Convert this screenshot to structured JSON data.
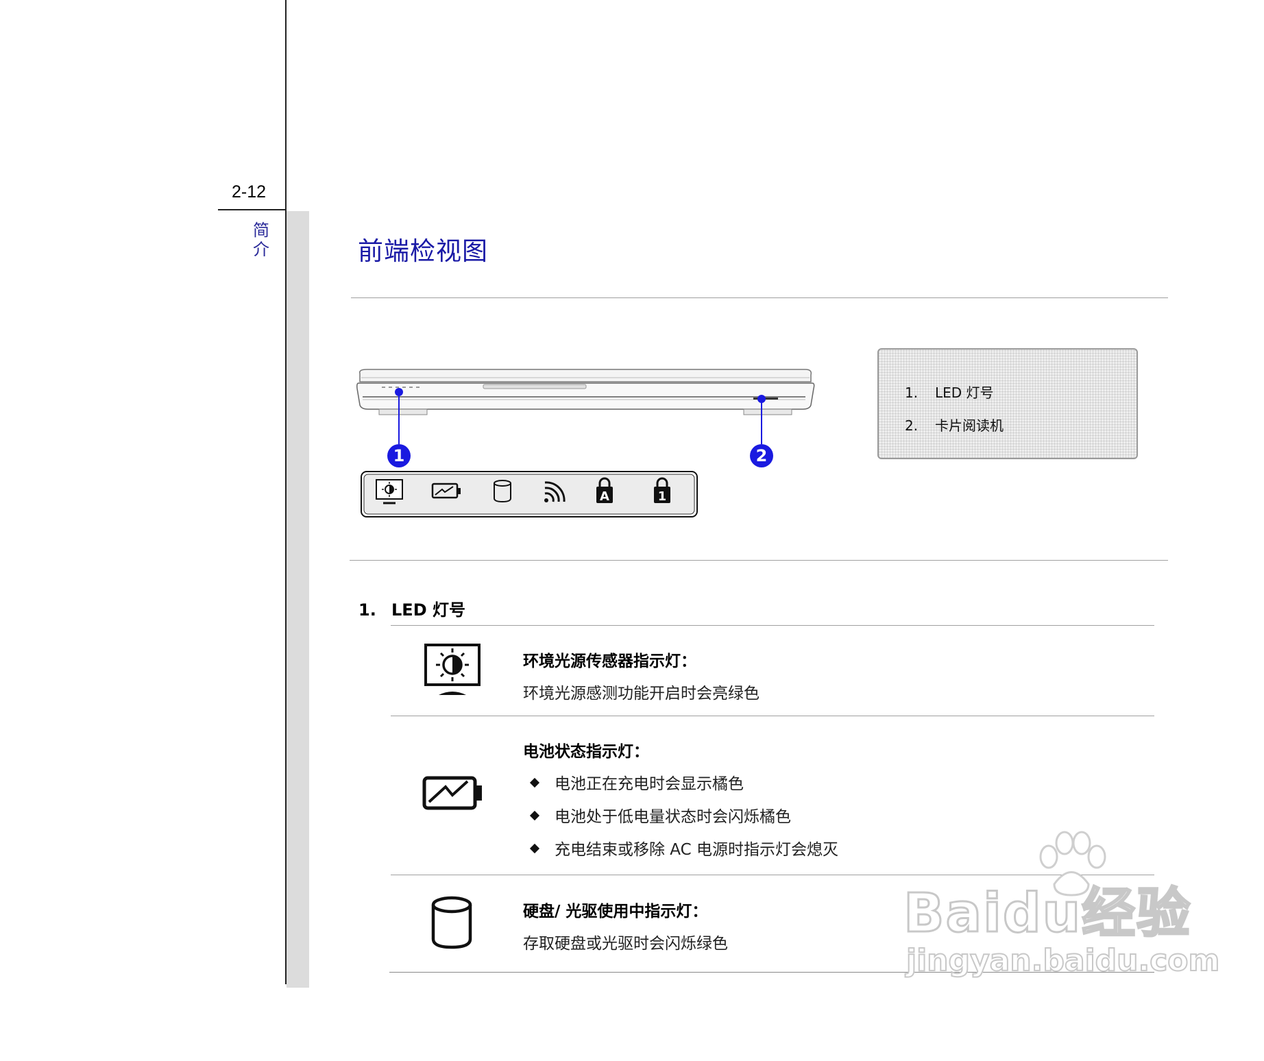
{
  "page": {
    "number": "2-12",
    "chapter": "简介",
    "title": "前端检视图"
  },
  "legend": {
    "items": [
      {
        "num": "1.",
        "label": "LED 灯号"
      },
      {
        "num": "2.",
        "label": "卡片阅读机"
      }
    ]
  },
  "callouts": [
    "1",
    "2"
  ],
  "indicator_strip": {
    "icons": [
      "ambient-light-sensor-icon",
      "battery-icon",
      "hdd-odd-icon",
      "wireless-icon",
      "caps-lock-icon",
      "num-lock-icon"
    ]
  },
  "section": {
    "num": "1.",
    "title": "LED 灯号"
  },
  "indicators": {
    "ambient": {
      "title": "环境光源传感器指示灯：",
      "desc": "环境光源感测功能开启时会亮绿色"
    },
    "battery": {
      "title": "电池状态指示灯：",
      "bullets": [
        "电池正在充电时会显示橘色",
        "电池处于低电量状态时会闪烁橘色",
        "充电结束或移除 AC 电源时指示灯会熄灭"
      ]
    },
    "hdd": {
      "title": "硬盘/ 光驱使用中指示灯：",
      "desc": "存取硬盘或光驱时会闪烁绿色"
    }
  },
  "watermark": {
    "brand": "Baidu经验",
    "url": "jingyan.baidu.com"
  },
  "colors": {
    "title_blue": "#1a1aa6",
    "callout_blue": "#1a1ae0",
    "sidebar_gray": "#dcdcdc"
  }
}
